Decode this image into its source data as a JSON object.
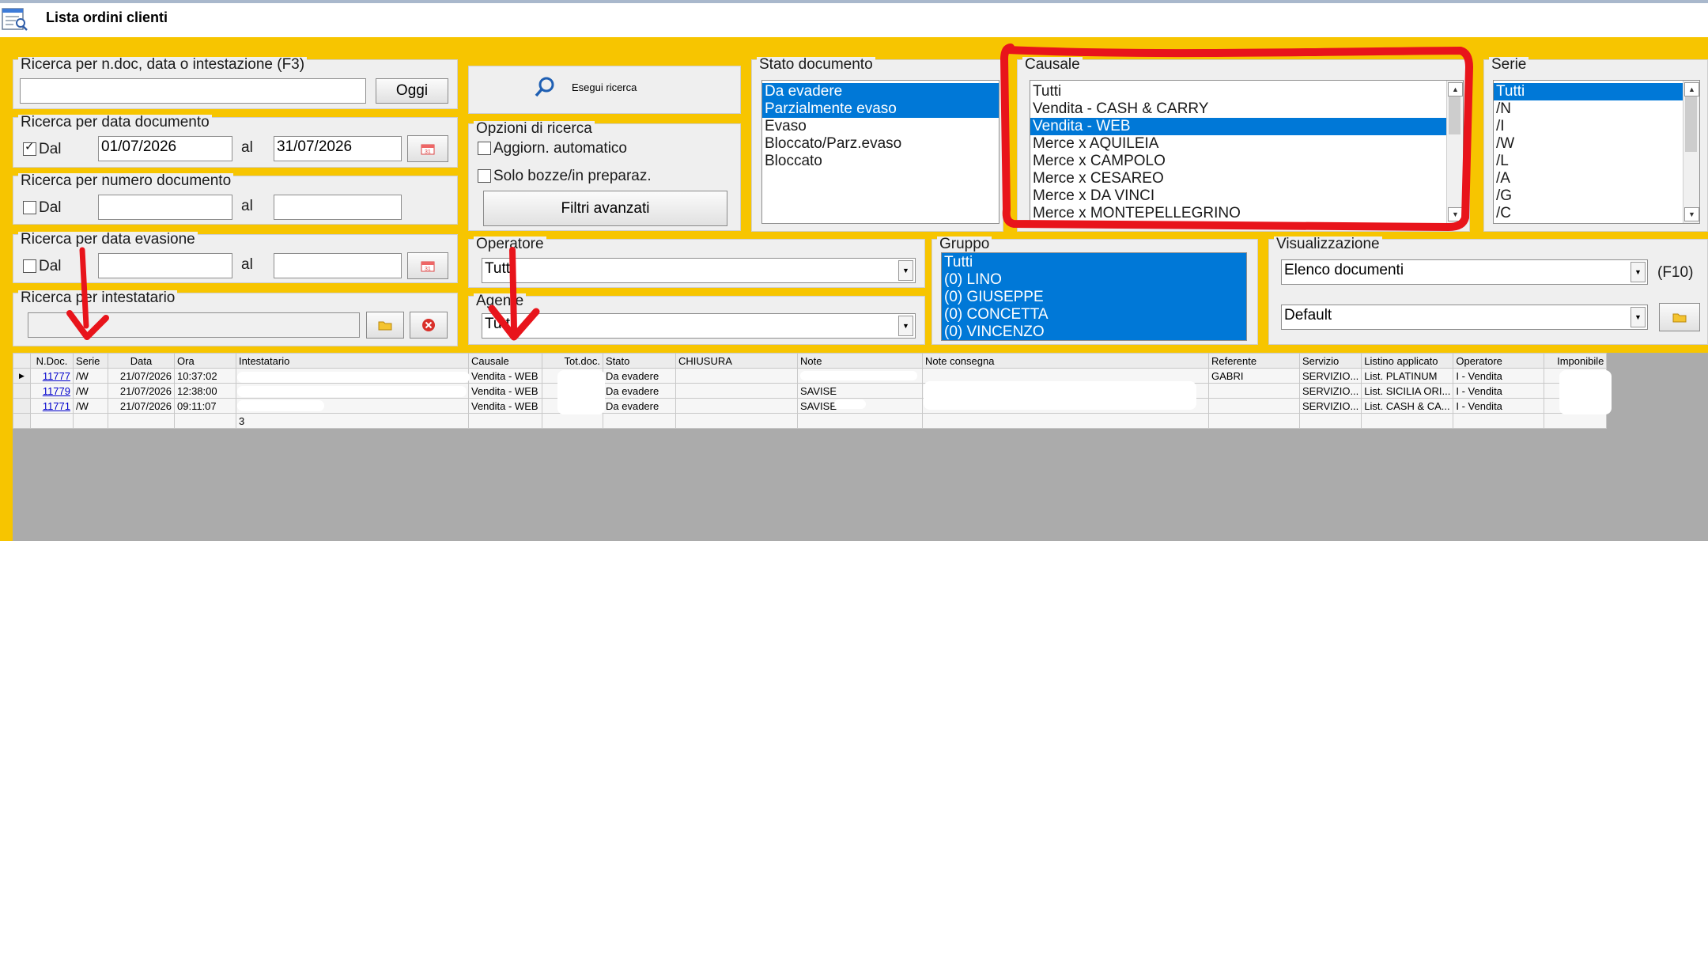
{
  "window": {
    "title": "Lista ordini clienti"
  },
  "search_text": {
    "label": "Ricerca per n.doc, data o intestazione (F3)",
    "value": "",
    "today_button": "Oggi",
    "run_button": "Esegui ricerca"
  },
  "doc_date": {
    "label": "Ricerca per data documento",
    "from_label": "Dal",
    "from_checked": true,
    "from": "01/07/2026",
    "to_label": "al",
    "to": "31/07/2026"
  },
  "doc_number": {
    "label": "Ricerca per numero documento",
    "from_label": "Dal",
    "to_label": "al",
    "from": "",
    "to": ""
  },
  "eva_date": {
    "label": "Ricerca per data evasione",
    "from_label": "Dal",
    "to_label": "al",
    "from": "",
    "to": ""
  },
  "holder": {
    "label": "Ricerca per intestatario",
    "value": ""
  },
  "options": {
    "label": "Opzioni di ricerca",
    "auto_update": "Aggiorn. automatico",
    "drafts_only": "Solo bozze/in preparaz.",
    "advanced_filters": "Filtri avanzati"
  },
  "operator": {
    "label": "Operatore",
    "value": "Tutti"
  },
  "agent": {
    "label": "Agente",
    "value": "Tutti"
  },
  "doc_status": {
    "label": "Stato documento",
    "items": [
      "Da evadere",
      "Parzialmente evaso",
      "Evaso",
      "Bloccato/Parz.evaso",
      "Bloccato"
    ],
    "selected": [
      0,
      1
    ]
  },
  "causale": {
    "label": "Causale",
    "items": [
      "Tutti",
      "Vendita - CASH & CARRY",
      "Vendita - WEB",
      "Merce x AQUILEIA",
      "Merce x CAMPOLO",
      "Merce x CESAREO",
      "Merce x DA VINCI",
      "Merce x MONTEPELLEGRINO"
    ],
    "selected": [
      2
    ]
  },
  "serie": {
    "label": "Serie",
    "items": [
      "Tutti",
      "/N",
      "/I",
      "/W",
      "/L",
      "/A",
      "/G",
      "/C"
    ],
    "selected": [
      0
    ]
  },
  "gruppo": {
    "label": "Gruppo",
    "items": [
      "Tutti",
      "(0) LINO",
      "(0) GIUSEPPE",
      "(0) CONCETTA",
      "(0) VINCENZO"
    ]
  },
  "visual": {
    "label": "Visualizzazione",
    "view": "Elenco documenti",
    "hotkey": "(F10)",
    "layout": "Default"
  },
  "table": {
    "headers": [
      "N.Doc.",
      "Serie",
      "Data",
      "Ora",
      "Intestatario",
      "Causale",
      "Tot.doc.",
      "Stato",
      "CHIUSURA",
      "Note",
      "Note consegna",
      "Referente",
      "Servizio",
      "Listino applicato",
      "Operatore",
      "Imponibile"
    ],
    "rows": [
      {
        "ndoc": "11777",
        "serie": "/W",
        "data": "21/07/2026",
        "ora": "10:37:02",
        "intestatario": "",
        "causale": "Vendita - WEB",
        "tot": "",
        "stato": "Da evadere",
        "chiusura": "",
        "note": "",
        "note_consegna": "",
        "referente": "GABRI",
        "servizio": "SERVIZIO...",
        "listino": "List. PLATINUM",
        "operatore": "I - Vendita",
        "imponibile": ""
      },
      {
        "ndoc": "11779",
        "serie": "/W",
        "data": "21/07/2026",
        "ora": "12:38:00",
        "intestatario": "",
        "causale": "Vendita - WEB",
        "tot": "",
        "stato": "Da evadere",
        "chiusura": "",
        "note": "SAVISE",
        "note_consegna": "",
        "referente": "",
        "servizio": "SERVIZIO...",
        "listino": "List. SICILIA ORI...",
        "operatore": "I - Vendita",
        "imponibile": ""
      },
      {
        "ndoc": "11771",
        "serie": "/W",
        "data": "21/07/2026",
        "ora": "09:11:07",
        "intestatario": "",
        "causale": "Vendita - WEB",
        "tot": "",
        "stato": "Da evadere",
        "chiusura": "",
        "note": "SAVISE",
        "note_consegna": "",
        "referente": "",
        "servizio": "SERVIZIO...",
        "listino": "List. CASH & CA...",
        "operatore": "I - Vendita",
        "imponibile": ""
      }
    ],
    "count": "3"
  },
  "colors": {
    "frame": "#f7c500",
    "selection": "#0078d7",
    "annotation": "#e8141b",
    "grid_bg": "#ababab"
  }
}
